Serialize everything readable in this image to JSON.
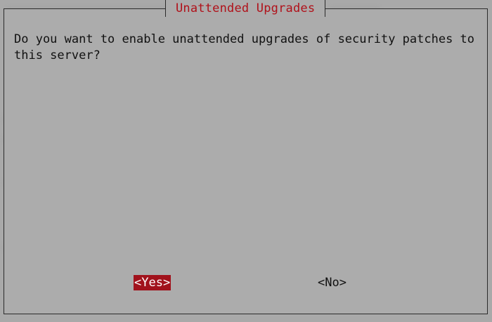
{
  "dialog": {
    "title": "Unattended Upgrades",
    "prompt": "Do you want to enable unattended upgrades of security patches to this server?",
    "buttons": {
      "yes": "<Yes>",
      "no": "<No>"
    }
  },
  "colors": {
    "background": "#a9a9a9",
    "dialog_background": "#acacac",
    "title_text": "#b0111a",
    "selected_button_bg": "#a1121c",
    "selected_button_text": "#ffffff",
    "border": "#2b2b2b",
    "text": "#111111"
  }
}
